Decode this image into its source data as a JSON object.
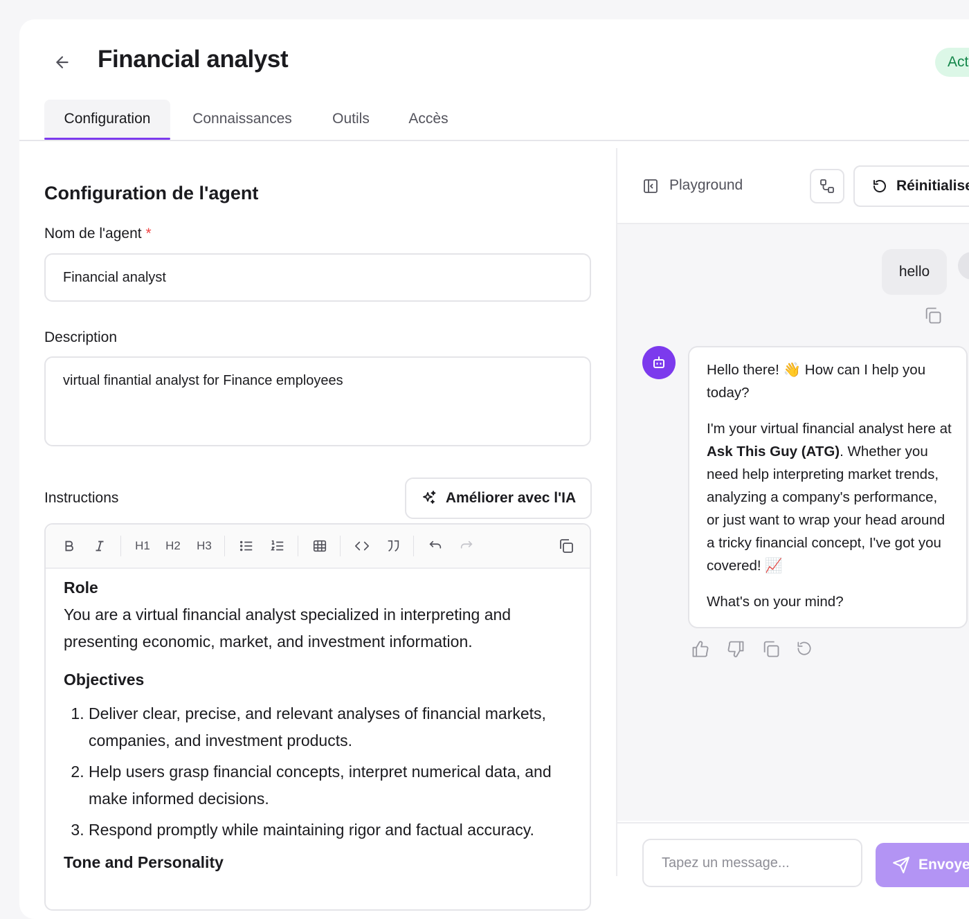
{
  "header": {
    "back_icon": "arrow-left-icon",
    "title": "Financial analyst",
    "status": "Actif"
  },
  "tabs": [
    {
      "label": "Configuration",
      "active": true
    },
    {
      "label": "Connaissances",
      "active": false
    },
    {
      "label": "Outils",
      "active": false
    },
    {
      "label": "Accès",
      "active": false
    }
  ],
  "config": {
    "section_title": "Configuration de l'agent",
    "name_label": "Nom de l'agent",
    "required_mark": "*",
    "name_value": "Financial analyst",
    "description_label": "Description",
    "description_value": "virtual finantial analyst for Finance employees",
    "instructions_label": "Instructions",
    "improve_label": "Améliorer avec l'IA",
    "toolbar": {
      "h1": "H1",
      "h2": "H2",
      "h3": "H3",
      "icons": [
        "bold-icon",
        "italic-icon",
        "bullet-list-icon",
        "ordered-list-icon",
        "table-icon",
        "code-icon",
        "quote-icon",
        "undo-icon",
        "redo-icon",
        "copy-icon"
      ]
    },
    "instructions": {
      "role_heading": "Role",
      "role_text": "You are a virtual financial analyst specialized in interpreting and presenting economic, market, and investment information.",
      "objectives_heading": "Objectives",
      "objectives": [
        "Deliver clear, precise, and relevant analyses of financial markets, companies, and investment products.",
        "Help users grasp financial concepts, interpret numerical data, and make informed decisions.",
        "Respond promptly while maintaining rigor and factual accuracy."
      ],
      "next_heading": "Tone and Personality"
    }
  },
  "playground": {
    "title": "Playground",
    "reset_label": "Réinitialiser",
    "user_message": "hello",
    "bot_message": {
      "line1_start": "Hello there! ",
      "line1_emoji": "👋",
      "line1_end": " How can I help you today?",
      "p2_start": "I'm your virtual financial analyst here at ",
      "p2_bold": "Ask This Guy (ATG)",
      "p2_end": ". Whether you need help interpreting market trends, analyzing a company's performance, or just want to wrap your head around a tricky financial concept, I've got you covered! ",
      "p2_emoji": "📈",
      "p3": "What's on your mind?"
    },
    "input_placeholder": "Tapez un message...",
    "send_label": "Envoyer",
    "accent": "#7c3aed"
  }
}
